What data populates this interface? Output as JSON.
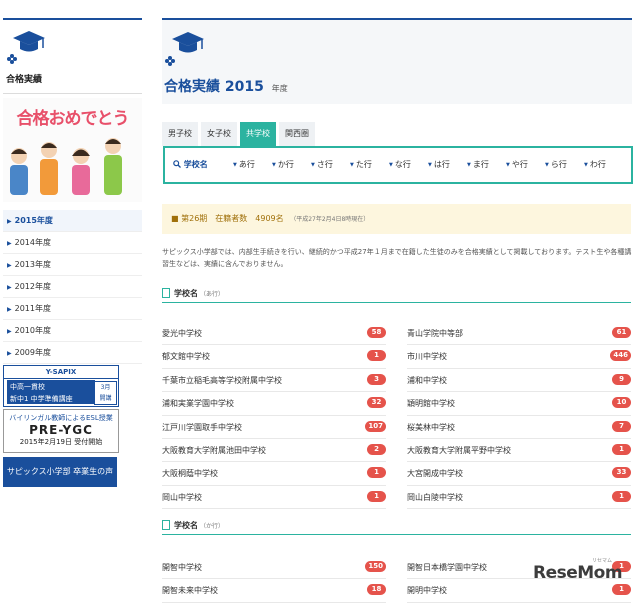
{
  "sidebar": {
    "title": "合格実績",
    "banner_headline": "合格おめでとう",
    "years": [
      "2015年度",
      "2014年度",
      "2013年度",
      "2012年度",
      "2011年度",
      "2010年度",
      "2009年度"
    ],
    "ad1": {
      "brand": "Y-SAPIX",
      "line1": "中高一貫校",
      "line2": "新中1 中学準備講座",
      "badge1": "3月",
      "badge2": "開講"
    },
    "ad2": {
      "line1": "バイリンガル教師によるESL授業",
      "line2": "PRE-YGC",
      "line3": "2015年2月19日 受付開始"
    },
    "ad3": {
      "label": "サピックス小学部 卒業生の声"
    }
  },
  "main": {
    "title": "合格実績",
    "year": "2015",
    "year_suffix": "年度",
    "tabs": [
      "男子校",
      "女子校",
      "共学校",
      "関西圏"
    ],
    "search": {
      "label": "学校名",
      "rows": [
        "あ行",
        "か行",
        "さ行",
        "た行",
        "な行",
        "は行",
        "ま行",
        "や行",
        "ら行",
        "わ行"
      ]
    },
    "notice": {
      "text": "第26期　在籍者数　4909名",
      "note": "（平成27年2月4日8時現在）"
    },
    "description": "サピックス小学部では、内部生手続きを行い、継続的かつ平成27年１月まで在籍した生徒のみを合格実績として掲載しております。テスト生や各種講習生などは、実績に含んでおりません。",
    "sections": [
      {
        "title": "学校名",
        "subtitle": "（あ行）",
        "left": [
          {
            "name": "愛光中学校",
            "count": "58"
          },
          {
            "name": "郁文館中学校",
            "count": "1"
          },
          {
            "name": "千葉市立稲毛高等学校附属中学校",
            "count": "3"
          },
          {
            "name": "浦和実業学園中学校",
            "count": "32"
          },
          {
            "name": "江戸川学園取手中学校",
            "count": "107"
          },
          {
            "name": "大阪教育大学附属池田中学校",
            "count": "2"
          },
          {
            "name": "大阪桐蔭中学校",
            "count": "1"
          },
          {
            "name": "岡山中学校",
            "count": "1"
          }
        ],
        "right": [
          {
            "name": "青山学院中等部",
            "count": "61"
          },
          {
            "name": "市川中学校",
            "count": "446"
          },
          {
            "name": "浦和中学校",
            "count": "9"
          },
          {
            "name": "穎明館中学校",
            "count": "10"
          },
          {
            "name": "桜美林中学校",
            "count": "7"
          },
          {
            "name": "大阪教育大学附属平野中学校",
            "count": "1"
          },
          {
            "name": "大宮開成中学校",
            "count": "33"
          },
          {
            "name": "岡山白陵中学校",
            "count": "1"
          }
        ]
      },
      {
        "title": "学校名",
        "subtitle": "（か行）",
        "left": [
          {
            "name": "開智中学校",
            "count": "150"
          },
          {
            "name": "開智未来中学校",
            "count": "18"
          }
        ],
        "right": [
          {
            "name": "開智日本橋学園中学校",
            "count": "1"
          },
          {
            "name": "開明中学校",
            "count": "1"
          }
        ]
      }
    ]
  },
  "watermark": {
    "brand": "ReseMom",
    "small": "リセマム"
  },
  "colors": {
    "primary": "#1a4f9c",
    "teal": "#2bb3a0",
    "badge": "#e5534b",
    "notice_bg": "#fdf6de"
  }
}
